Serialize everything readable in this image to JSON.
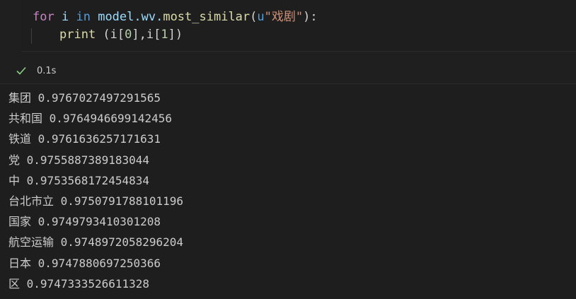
{
  "code": {
    "line1": {
      "kw_for": "for",
      "var_i": "i",
      "kw_in": "in",
      "obj": "model.wv.",
      "fn": "most_similar",
      "open": "(",
      "str_prefix": "u",
      "str": "\"戏剧\"",
      "close": "):"
    },
    "line2": {
      "fn": "print",
      "args_a": " (i[",
      "num0": "0",
      "args_b": "],i[",
      "num1": "1",
      "args_c": "])"
    }
  },
  "status": {
    "icon": "check-icon",
    "time": "0.1s",
    "color": "#89d185"
  },
  "output": [
    {
      "word": "集团",
      "score": "0.9767027497291565"
    },
    {
      "word": "共和国",
      "score": "0.9764946699142456"
    },
    {
      "word": "铁道",
      "score": "0.9761636257171631"
    },
    {
      "word": "党",
      "score": "0.9755887389183044"
    },
    {
      "word": "中",
      "score": "0.9753568172454834"
    },
    {
      "word": "台北市立",
      "score": "0.9750791788101196"
    },
    {
      "word": "国家",
      "score": "0.9749793410301208"
    },
    {
      "word": "航空运输",
      "score": "0.9748972058296204"
    },
    {
      "word": "日本",
      "score": "0.9747880697250366"
    },
    {
      "word": "区",
      "score": "0.9747333526611328"
    }
  ]
}
